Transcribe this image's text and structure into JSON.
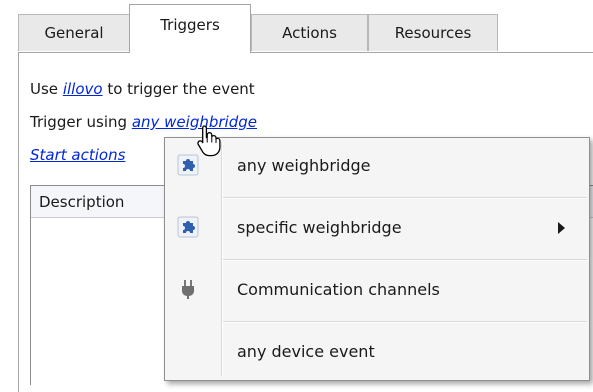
{
  "tabs": [
    {
      "label": "General",
      "active": false
    },
    {
      "label": "Triggers",
      "active": true
    },
    {
      "label": "Actions",
      "active": false
    },
    {
      "label": "Resources",
      "active": false
    }
  ],
  "triggers": {
    "use_prefix": "Use",
    "device_link": "illovo",
    "use_suffix": "to trigger the event",
    "trigger_prefix": "Trigger using",
    "trigger_link": "any weighbridge",
    "start_actions_link": "Start actions"
  },
  "grid": {
    "columns": [
      "Description"
    ]
  },
  "context_menu": {
    "items": [
      {
        "label": "any weighbridge",
        "icon": "puzzle-icon"
      },
      {
        "label": "specific weighbridge",
        "icon": "puzzle-icon",
        "submenu": true
      },
      {
        "label": "Communication channels",
        "icon": "plug-icon"
      },
      {
        "label": "any device event",
        "icon": ""
      }
    ]
  },
  "colors": {
    "link": "#0026d9",
    "menu_bg": "#f5f5f5",
    "accent": "#2f5fae"
  }
}
